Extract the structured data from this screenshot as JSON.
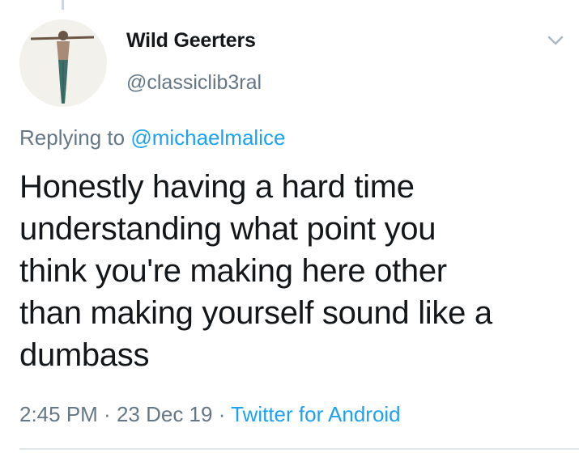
{
  "tweet": {
    "author": {
      "display_name": "Wild Geerters",
      "handle": "@classiclib3ral",
      "avatar_icon": "avatar-photo"
    },
    "menu_icon": "chevron-down-icon",
    "reply": {
      "prefix": "Replying to ",
      "mention": "@michaelmalice"
    },
    "text": "Honestly having a hard time\nunderstanding what point you\nthink you're making here other\nthan making yourself sound like a\ndumbass",
    "meta": {
      "time": "2:45 PM",
      "separator": " · ",
      "date": "23 Dec 19",
      "separator2": " · ",
      "source": "Twitter for Android"
    }
  },
  "colors": {
    "text": "#14171a",
    "secondary": "#657786",
    "link": "#1da1f2",
    "divider": "#e1e8ed"
  }
}
